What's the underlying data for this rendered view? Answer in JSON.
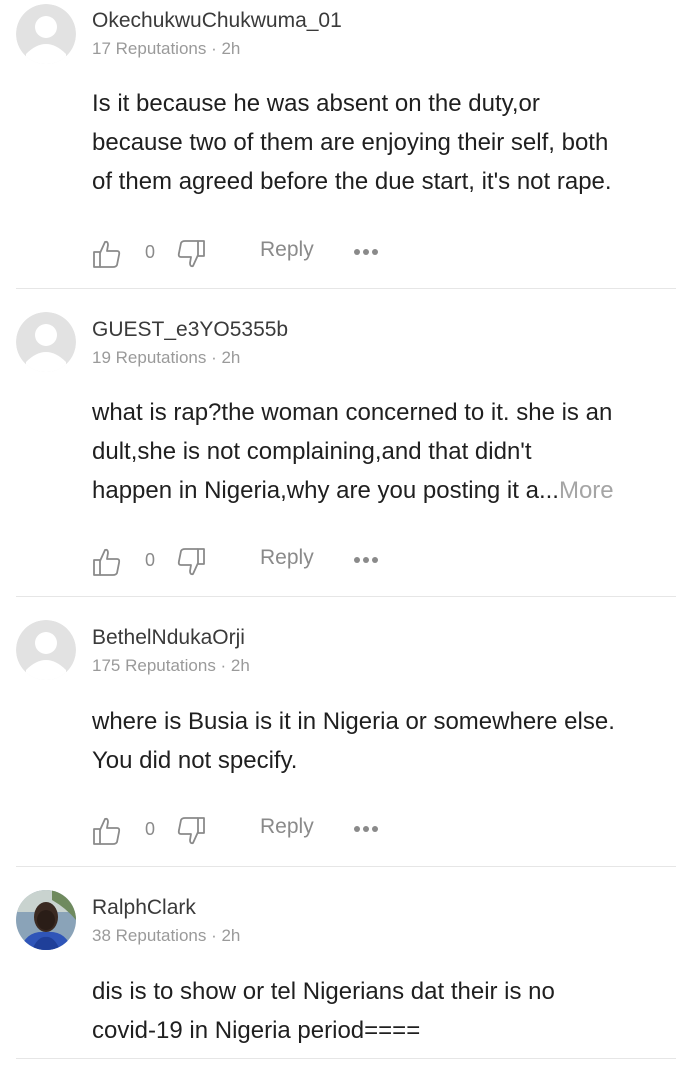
{
  "comments": [
    {
      "username": "OkechukwuChukwuma_01",
      "meta": "17 Reputations · 2h",
      "lines": [
        "Is it because he was absent on the duty,or",
        "because two of them are enjoying their self, both",
        "of them agreed before the due start, it's not rape."
      ],
      "likes": "0",
      "reply_label": "Reply",
      "avatar": "default-avatar-icon"
    },
    {
      "username": "GUEST_e3YO5355b",
      "meta": "19 Reputations · 2h",
      "lines": [
        "what is rap?the woman concerned to it. she is an",
        "dult,she is not complaining,and that  didn't",
        "happen in Nigeria,why are you posting it a..."
      ],
      "more_label": "More",
      "likes": "0",
      "reply_label": "Reply",
      "avatar": "default-avatar-icon"
    },
    {
      "username": "BethelNdukaOrji",
      "meta": "175 Reputations · 2h",
      "lines": [
        "where is Busia is it in Nigeria or somewhere else.",
        "You did not specify."
      ],
      "likes": "0",
      "reply_label": "Reply",
      "avatar": "default-avatar-icon"
    },
    {
      "username": "RalphClark",
      "meta": "38 Reputations · 2h",
      "lines": [
        "dis is to show or tel Nigerians dat their is no",
        "covid-19 in Nigeria period===="
      ],
      "avatar": "user-photo-avatar"
    }
  ],
  "colors": {
    "text": "#1f1f1f",
    "username": "#3a3a3a",
    "meta": "#9a9a9a",
    "action": "#8a8a8a",
    "divider": "#e6e6e6",
    "avatar_bg": "#e2e2e2"
  },
  "icons": {
    "like": "thumbs-up-icon",
    "dislike": "thumbs-down-icon",
    "more": "more-dots-icon"
  }
}
